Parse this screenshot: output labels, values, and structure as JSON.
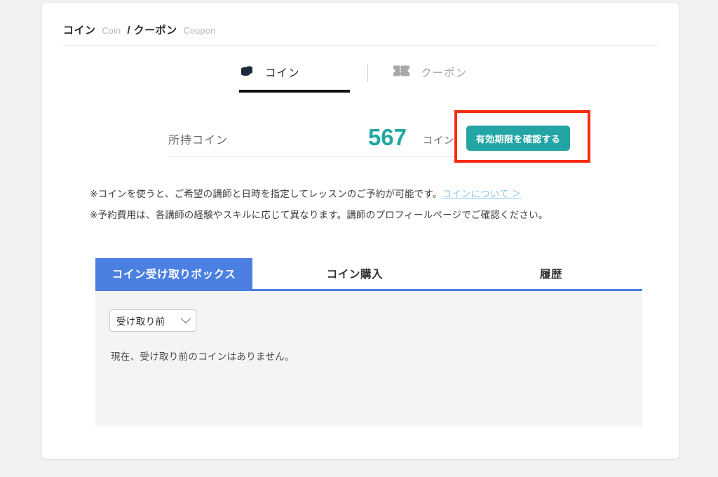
{
  "breadcrumb": {
    "primary_ja": "コイン",
    "primary_en": "Coin",
    "separator": "/",
    "secondary_ja": "クーポン",
    "secondary_en": "Coupon"
  },
  "type_tabs": [
    {
      "label": "コイン",
      "icon": "coin-stack-icon",
      "active": true
    },
    {
      "label": "クーポン",
      "icon": "ticket-icon",
      "active": false
    }
  ],
  "balance": {
    "label": "所持コイン",
    "value": "567",
    "unit": "コイン",
    "value_color": "#21a8a0"
  },
  "expiry_button": {
    "label": "有効期限を確認する",
    "background": "#23a5a5",
    "text_color": "#ffffff"
  },
  "annotation": {
    "color": "#f72c11"
  },
  "notes": {
    "line1_text": "※コインを使うと、ご希望の講師と日時を指定してレッスンのご予約が可能です。",
    "line1_link": "コインについて ＞",
    "line1_link_color": "#8ec7ee",
    "line2_text": "※予約費用は、各講師の経験やスキルに応じて異なります。講師のプロフィールページでご確認ください。"
  },
  "section_tabs": {
    "active_color": "#4b7fe2",
    "items": [
      {
        "label": "コイン受け取りボックス",
        "active": true
      },
      {
        "label": "コイン購入",
        "active": false
      },
      {
        "label": "履歴",
        "active": false
      }
    ]
  },
  "panel": {
    "filter": {
      "selected": "受け取り前",
      "icon": "chevron-down-icon"
    },
    "empty_message": "現在、受け取り前のコインはありません。"
  }
}
